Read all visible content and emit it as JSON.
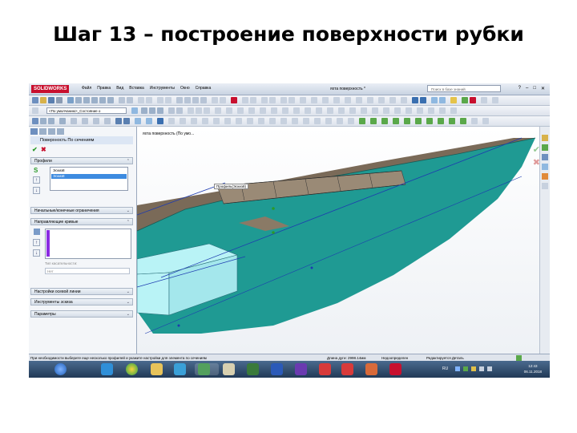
{
  "slide": {
    "title": "Шаг 13 – построение поверхности рубки"
  },
  "app": {
    "logo": "SOLIDWORKS",
    "menu": [
      "Файл",
      "Правка",
      "Вид",
      "Вставка",
      "Инструменты",
      "Окно",
      "Справка"
    ],
    "doc_title": "яхта поверхность *",
    "search_placeholder": "Поиск в базе знаний"
  },
  "toolbar": {
    "config_combo": "<По умолчанию>_Состояние о"
  },
  "panel": {
    "title": "Поверхность По сечениям",
    "sections": {
      "profiles": "Профили",
      "start_end": "Начальные/конечные ограничения",
      "guides": "Направляющие кривые",
      "centerline": "Настройки осевой линии",
      "sketch_tools": "Инструменты эскиза",
      "options": "Параметры"
    },
    "profiles": [
      "Эскиз8",
      "Эскиз8"
    ],
    "tangency_label": "Тип касательности:",
    "tangency_value": "Нет"
  },
  "graphics": {
    "breadcrumb": "яхта поверхность (По умо...",
    "profile_tag": "Профиль(Эскиз8)"
  },
  "statusbar": {
    "hint": "При необходимости выберите еще несколько профилей и укажите настройки для элемента по сечениям",
    "length": "Длина дуги: 2998.14мм",
    "state": "Недоопределен",
    "editing": "Редактируется Деталь"
  },
  "taskbar": {
    "time": "12:43",
    "date": "06.11.2018"
  },
  "colors": {
    "hull": "#1f9a93",
    "deck": "#7a6a58",
    "cabin": "#b9f3f6",
    "accent_red": "#c8102e"
  }
}
